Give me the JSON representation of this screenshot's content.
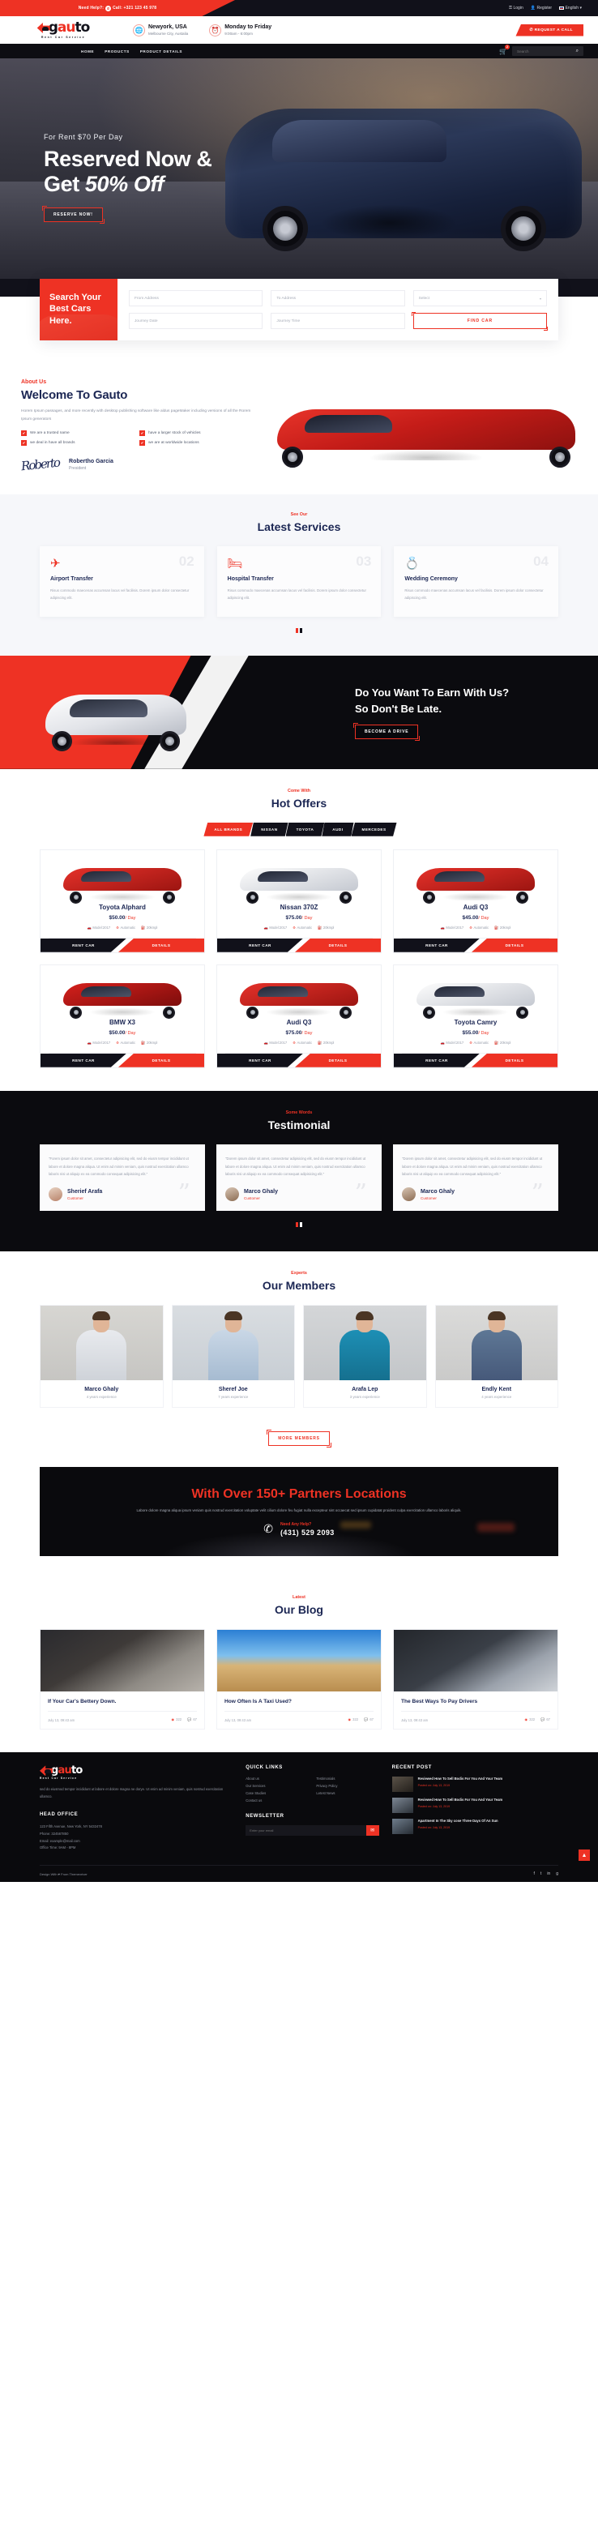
{
  "topbar": {
    "help_label": "Need Help?:",
    "phone_icon": "phone-icon",
    "call_label": "Call: +321 123 45 978",
    "login": "Login",
    "register": "Register",
    "language": "English",
    "lang_caret": "▾"
  },
  "brand": {
    "name_g": "g",
    "name_a": "au",
    "name_u": "to",
    "tagline": "Rent Car Service"
  },
  "header": {
    "location_title": "Newyork, USA",
    "location_sub": "Melbourne City, Austalia",
    "hours_title": "Monday to Friday",
    "hours_sub": "9:00am - 6:00pm",
    "request_call": "REQUEST A CALL",
    "globe_icon": "globe-icon",
    "clock_icon": "alarm-clock-icon"
  },
  "nav": {
    "items": [
      "HOME",
      "PRODUCTS",
      "PRODUCT DETAILS"
    ],
    "cart_count": "2",
    "cart_icon": "shopping-cart-icon",
    "search_placeholder": "Search",
    "search_icon": "search-icon"
  },
  "hero": {
    "eyebrow": "For Rent $70 Per Day",
    "title_line1": "Reserved Now &",
    "title_line2_plain": "Get ",
    "title_line2_italic": "50% Off",
    "cta": "RESERVE NOW!"
  },
  "search_form": {
    "heading": "Search Your Best Cars Here.",
    "from_placeholder": "From Address",
    "to_placeholder": "To Address",
    "select_placeholder": "Select",
    "date_placeholder": "Journey Date",
    "time_placeholder": "Journey Time",
    "submit": "FIND CAR"
  },
  "about": {
    "eyebrow": "About Us",
    "title": "Welcome To Gauto",
    "paragraph": "Horem Ipsum passages, and more recently with desktop publishing software like aldus pageMaker including versions of all the Rorem Ipsum generators",
    "checks": [
      "We are a trusted name",
      "have a larger stock of vehicles",
      "we deal in have all brands",
      "we are at worldwide locations"
    ],
    "signature_glyph": "Roberto",
    "person_name": "Robertho Garcia",
    "person_role": "President"
  },
  "services": {
    "eyebrow": "See Our",
    "title": "Latest Services",
    "cards": [
      {
        "num": "02",
        "icon": "airplane-icon",
        "glyph": "✈",
        "title": "Airport Transfer",
        "text": "Risus commodo maecenas accumsan lacus vel facilisis. Dorem ipsum dolor consectetur adipiscing elit."
      },
      {
        "num": "03",
        "icon": "hospital-bed-icon",
        "glyph": "🛏",
        "title": "Hospital Transfer",
        "text": "Risus commodo maecenas accumsan lacus vel facilisis. Dorem ipsum dolor consectetur adipiscing elit."
      },
      {
        "num": "04",
        "icon": "wedding-rings-icon",
        "glyph": "💍",
        "title": "Wedding Ceremony",
        "text": "Risus commodo maecenas accumsan lacus vel facilisis. Dorem ipsum dolor consectetur adipiscing elit."
      }
    ]
  },
  "earn": {
    "line1": "Do You Want To Earn With Us?",
    "line2": "So Don't Be Late.",
    "cta": "BECOME A DRIVE"
  },
  "offers": {
    "eyebrow": "Come With",
    "title": "Hot Offers",
    "tabs": [
      "ALL BRANDS",
      "NISSAN",
      "TOYOTA",
      "AUDI",
      "MERCEDES"
    ],
    "active_tab": "ALL BRANDS",
    "spec_labels": {
      "model": "Model:2017",
      "transmission": "Automatic",
      "mileage": "20kmpl"
    },
    "rent_label": "RENT CAR",
    "details_label": "DETAILS",
    "per_day": "/ Day",
    "cars": [
      {
        "name": "Toyota Alphard",
        "price": "$50.00",
        "color": "red-b"
      },
      {
        "name": "Nissan 370Z",
        "price": "$75.00",
        "color": "white-b"
      },
      {
        "name": "Audi Q3",
        "price": "$45.00",
        "color": "red-b"
      },
      {
        "name": "BMW X3",
        "price": "$50.00",
        "color": "darkred-b"
      },
      {
        "name": "Audi Q3",
        "price": "$75.00",
        "color": "red-b"
      },
      {
        "name": "Toyota Camry",
        "price": "$55.00",
        "color": "white-b"
      }
    ]
  },
  "testimonial": {
    "eyebrow": "Some Words",
    "title": "Testimonial",
    "items": [
      {
        "text": "\"Forem ipsum dolor sit amet, consectetur adipisicing elit, sed do eiusm tempor incididunt ut labore et dolore magna aliqua. Ut enim ad minim veniam, quis nostrud exercitation ullamco laboris nisi ut aliquip ex ea commodo consequat adipisicing elit.\"",
        "name": "Sherief Arafa",
        "role": "Customer"
      },
      {
        "text": "\"Dorem ipsum dolor sit amet, consectetur adipisicing elit, sed do eiusm tempor incididunt ut labore et dolore magna aliqua. Ut enim ad minim veniam, quis nostrud exercitation ullamco laboris nisi ut aliquip ex ea commodo consequat adipisicing elit.\"",
        "name": "Marco Ghaly",
        "role": "Customer"
      },
      {
        "text": "\"Dorem ipsum dolor sit amet, consectetur adipisicing elit, sed do eiusm tempor incididunt ut labore et dolore magna aliqua. Ut enim ad minim veniam, quis nostrud exercitation ullamco laboris nisi ut aliquip ex ea commodo consequat adipisicing elit.\"",
        "name": "Marco Ghaly",
        "role": "Customer"
      }
    ]
  },
  "members": {
    "eyebrow": "Experts",
    "title": "Our Members",
    "more_label": "MORE MEMBERS",
    "people": [
      {
        "name": "Marco Ghaly",
        "exp": "4 years experience"
      },
      {
        "name": "Sheref Joe",
        "exp": "7 years experience"
      },
      {
        "name": "Arafa Lep",
        "exp": "3 years experience"
      },
      {
        "name": "Endly Kent",
        "exp": "4 years experience"
      }
    ]
  },
  "partners": {
    "title_pre": "With Over ",
    "title_count": "150+",
    "title_post": " Partners Locations",
    "paragraph": "Labore dolore magna aliqua ipsum veniam quis nostrud exercitation voluptate velit cilium dolore feu fugiat nulla excepteur sint occaecat sed ipsum cupidatat proident culpa exercitation ullamco laboris aliquik.",
    "need_help": "Need Any Help?",
    "phone": "(431) 529 2093",
    "phone_icon": "phone-icon"
  },
  "blog": {
    "eyebrow": "Latest",
    "title": "Our Blog",
    "posts": [
      {
        "title": "If Your Car's Bettery Down.",
        "date": "July 13, 09:43 am",
        "views": "322",
        "comments": "67"
      },
      {
        "title": "How Often Is A Taxi Used?",
        "date": "July 13, 09:43 am",
        "views": "322",
        "comments": "67"
      },
      {
        "title": "The Best Ways To Pay Drivers",
        "date": "July 13, 09:43 am",
        "views": "322",
        "comments": "67"
      }
    ],
    "eye_icon": "eye-icon",
    "comment_icon": "comment-icon"
  },
  "footer": {
    "about_text": "sed do eiusmod tempor incididunt ut labore et dolore magna ne dorye. Ut enim ad minim veniam, quis nostrud exercitation ullamco.",
    "quick_links_title": "QUICK LINKS",
    "quick_links": [
      "About us",
      "Our Services",
      "Case Studies",
      "Contact us",
      "Testimonials",
      "Privacy Policy",
      "Letest News"
    ],
    "recent_post_title": "RECENT POST",
    "posts": [
      {
        "title": "Reviewed How To Sell Bodis For You And Your Team",
        "date": "Posted on: July 13, 2019"
      },
      {
        "title": "Reviewed How To Sell Bodis For You And Your Team",
        "date": "Posted on: July 13, 2019"
      },
      {
        "title": "Apartment In The Sky cose Three Days Of An Sun",
        "date": "Posted on: July 13, 2019"
      }
    ],
    "head_office_title": "HEAD OFFICE",
    "office_lines": [
      "123 Fifth Avenue, New York, NY 5432478",
      "Phone: 324567850",
      "Email: example@mail.com",
      "Office Time: 9AM - 8PM"
    ],
    "newsletter_title": "NEWSLETTER",
    "newsletter_placeholder": "Enter your email",
    "newsletter_button": "✉",
    "copyright": "Design With ♥ From Themexriver",
    "socials": [
      "f",
      "t",
      "in",
      "g"
    ],
    "to_top_icon": "arrow-up-icon",
    "to_top": "▲"
  },
  "colors": {
    "accent": "#ee3224",
    "dark": "#0b0b0f",
    "navy": "#1b2653"
  }
}
